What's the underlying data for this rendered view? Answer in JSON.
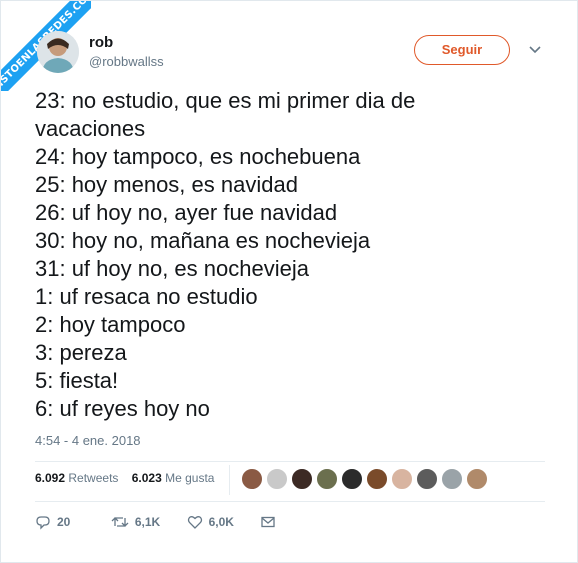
{
  "watermark": "VISTOENLASREDES.COM",
  "user": {
    "name": "rob",
    "handle": "@robbwallss",
    "follow_label": "Seguir"
  },
  "tweet": {
    "lines": [
      "23: no estudio, que es mi primer dia de",
      "vacaciones",
      "24: hoy tampoco, es nochebuena",
      "25: hoy menos, es navidad",
      "26: uf hoy no, ayer fue navidad",
      "30: hoy no, mañana es nochevieja",
      "31: uf hoy no, es nochevieja",
      "1: uf resaca no estudio",
      "2: hoy tampoco",
      "3: pereza",
      "5: fiesta!",
      "6: uf reyes hoy no"
    ],
    "timestamp": "4:54 - 4 ene. 2018"
  },
  "stats": {
    "retweets_count": "6.092",
    "retweets_label": "Retweets",
    "likes_count": "6.023",
    "likes_label": "Me gusta"
  },
  "likers": [
    {
      "icon": "avatar-1",
      "color": "#8a5a44"
    },
    {
      "icon": "avatar-2",
      "color": "#c9c9c9"
    },
    {
      "icon": "avatar-3",
      "color": "#3c2a24"
    },
    {
      "icon": "avatar-4",
      "color": "#6b6f4e"
    },
    {
      "icon": "avatar-5",
      "color": "#2b2b2b"
    },
    {
      "icon": "avatar-6",
      "color": "#7a4b2a"
    },
    {
      "icon": "avatar-7",
      "color": "#d8b4a0"
    },
    {
      "icon": "avatar-8",
      "color": "#5c5c5c"
    },
    {
      "icon": "avatar-9",
      "color": "#9aa3a8"
    },
    {
      "icon": "avatar-10",
      "color": "#b08a6a"
    }
  ],
  "actions": {
    "reply_count": "20",
    "retweet_count": "6,1K",
    "like_count": "6,0K"
  },
  "colors": {
    "accent": "#e0592a",
    "watermark": "#1da1f2",
    "muted": "#657786"
  }
}
